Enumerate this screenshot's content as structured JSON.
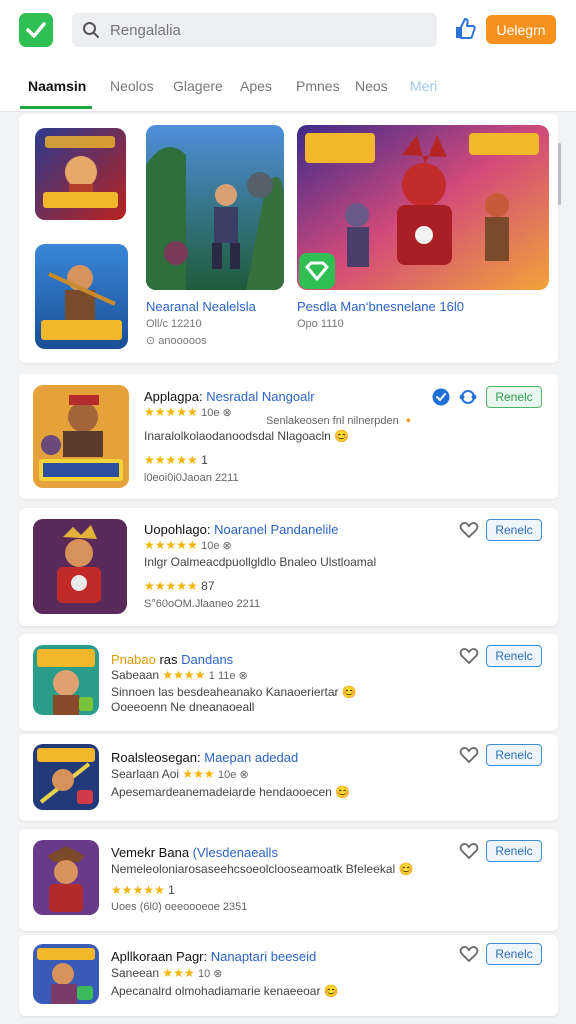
{
  "header": {
    "search_placeholder": "Rengalalia",
    "upgrade_label": "Uelegrn"
  },
  "tabs": [
    "Naamsin",
    "Neolos",
    "Glagere",
    "Apes",
    "Pmnes",
    "Neos",
    "Meri"
  ],
  "featured": {
    "item1": {
      "title": "Nearanal Nealelsla",
      "meta": "Oll/c 12210"
    },
    "item2": {
      "title": "Pesdla Man‘bnesnelane 16l0",
      "meta": "Opo 1110"
    },
    "footnote": "⊙ anooooos"
  },
  "list": [
    {
      "title_main": "Applagpa:",
      "title_sub": "Nesradal Nangoalr",
      "rating_stars": "★★★★★",
      "rating_meta": "10e ⊗",
      "note": "Senlakeosen fnl nilnerpden 🔸",
      "desc": "Inaralolkolaodanoodsdal Nlagoacln 😊",
      "stars2": "★★★★★",
      "stars2_count": "1",
      "footer": "l0eoi0i0Jaoan 2211",
      "button": "Renelc"
    },
    {
      "title_main": "Uopohlago:",
      "title_sub": "Noaranel Pandanelile",
      "rating_stars": "★★★★★",
      "rating_meta": "10e ⊗",
      "desc": "Inlgr Oalmeacdpuollgldlo Bnaleo Ulstloamal",
      "stars2": "★★★★★",
      "stars2_count": "87",
      "footer": "S°60oOM.Jlaaneo 2211",
      "button": "Renelc"
    },
    {
      "title_main": "Pnabao",
      "title_main2": "ras",
      "title_sub": "Dandans",
      "line2_prefix": "Sabeaan",
      "rating_stars": "★★★★",
      "rating_meta": "1 11e ⊗",
      "line3": "Sinnoen las besdeaheanako Kanaoeriertar 😊",
      "line4": "Ooeeoenn Ne dneanaoeall",
      "button": "Renelc"
    },
    {
      "title_main": "Roalsleosegan:",
      "title_sub": "Maepan adedad",
      "line2_prefix": "Searlaan",
      "line2_mid": "Aoi",
      "rating_stars": "★★★",
      "rating_meta": "10e ⊗",
      "line3": "Apesemardeanemadeiarde hendaooecen 😊",
      "button": "Renelc"
    },
    {
      "title_main": "Vemekr Bana",
      "title_sub": "(Vlesdenaealls",
      "line2": "Nemeleoloniarosaseehcsoeolclooseamoatk Bfeleekal 😊",
      "stars2": "★★★★★",
      "stars2_count": "1",
      "footer": "Uoes (6l0) oeeoooeoe 2351",
      "button": "Renelc"
    },
    {
      "title_main": "Apllkoraan Pagr:",
      "title_sub": "Nanaptari beeseid",
      "line2_prefix": "Saneean",
      "rating_stars": "★★★",
      "rating_meta": "10 ⊗",
      "line3": "Apecanalrd olmohadiamarie kenaeeoar 😊",
      "button": "Renelc"
    }
  ],
  "colors": {
    "brand_green": "#2fbf52",
    "accent_orange": "#f6911e",
    "link_blue": "#2a63c6",
    "star_gold": "#f5b400"
  }
}
